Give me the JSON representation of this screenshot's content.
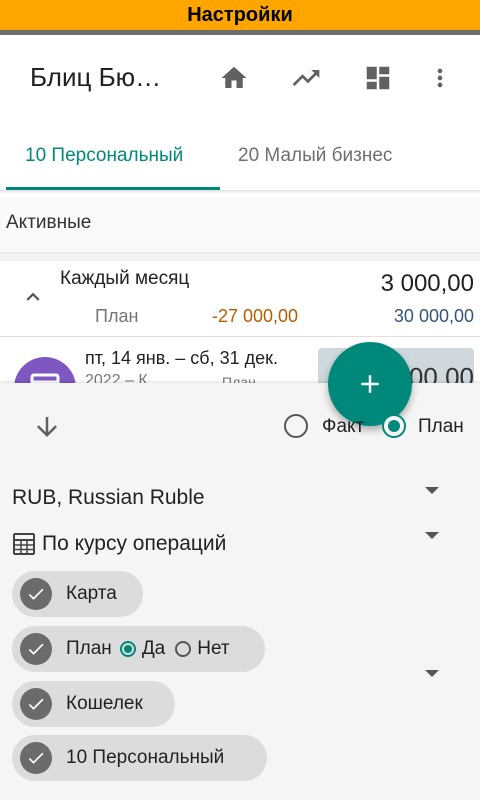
{
  "banner": {
    "title": "Настройки"
  },
  "appbar": {
    "title": "Блиц Бю…",
    "icons": [
      "home-icon",
      "trending-up-icon",
      "dashboard-icon",
      "more-vert-icon"
    ]
  },
  "tabs": [
    {
      "label": "10 Персональный",
      "active": true
    },
    {
      "label": "20 Малый бизнес",
      "active": false
    }
  ],
  "section": {
    "label": "Активные"
  },
  "budget_row": {
    "title": "Каждый месяц",
    "amount": "3 000,00",
    "plan_label": "План",
    "plan_spent": "-27 000,00",
    "plan_total": "30 000,00"
  },
  "next_item": {
    "date_range": "пт, 14 янв. – сб, 31 дек.",
    "sub_text": "2022 – К…",
    "sub_label": "План",
    "amount_partial": "00,00"
  },
  "sheet": {
    "radio_fact": "Факт",
    "radio_plan": "План",
    "selected_mode": "План",
    "currency": "RUB, Russian Ruble",
    "rate_mode": "По курсу операций",
    "chips": [
      {
        "label": "Карта",
        "checked": true
      },
      {
        "label": "План",
        "checked": true,
        "options": [
          "Да",
          "Нет"
        ],
        "selected": "Да"
      },
      {
        "label": "Кошелек",
        "checked": true
      },
      {
        "label": "10 Персональный",
        "checked": true
      }
    ]
  },
  "colors": {
    "accent": "#00897b",
    "banner": "#ffa500",
    "negative": "#b85c00",
    "positive": "#37557a"
  }
}
